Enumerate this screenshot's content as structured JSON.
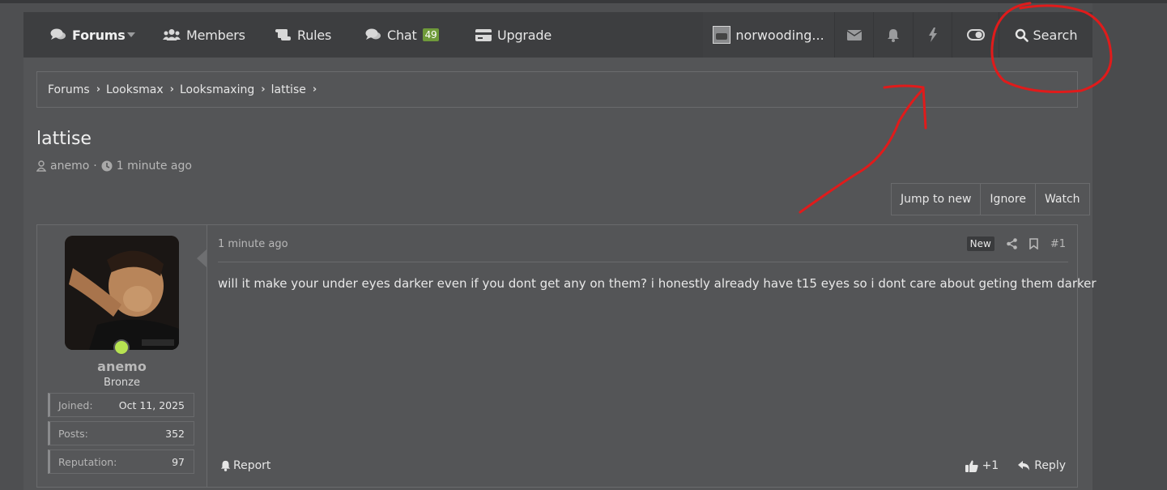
{
  "nav": {
    "forums": "Forums",
    "members": "Members",
    "rules": "Rules",
    "chat": "Chat",
    "chat_count": "49",
    "upgrade": "Upgrade",
    "username": "norwooding...",
    "search": "Search"
  },
  "breadcrumb": [
    "Forums",
    "Looksmax",
    "Looksmaxing",
    "lattise"
  ],
  "thread": {
    "title": "lattise",
    "author": "anemo",
    "time": "1 minute ago"
  },
  "actions": {
    "jump": "Jump to new",
    "ignore": "Ignore",
    "watch": "Watch"
  },
  "post": {
    "time": "1 minute ago",
    "badge": "New",
    "number": "#1",
    "body": "will it make your under eyes darker even if you dont get any on them? i honestly already have t15 eyes so i dont care about geting them darker",
    "report": "Report",
    "reaction": "+1",
    "reply": "Reply"
  },
  "user": {
    "name": "anemo",
    "rank": "Bronze",
    "stats": [
      {
        "k": "Joined:",
        "v": "Oct 11, 2025"
      },
      {
        "k": "Posts:",
        "v": "352"
      },
      {
        "k": "Reputation:",
        "v": "97"
      }
    ]
  },
  "colors": {
    "online": "#b7e352",
    "chat_badge": "#6f9a3a",
    "annotation": "#e01b1b"
  }
}
